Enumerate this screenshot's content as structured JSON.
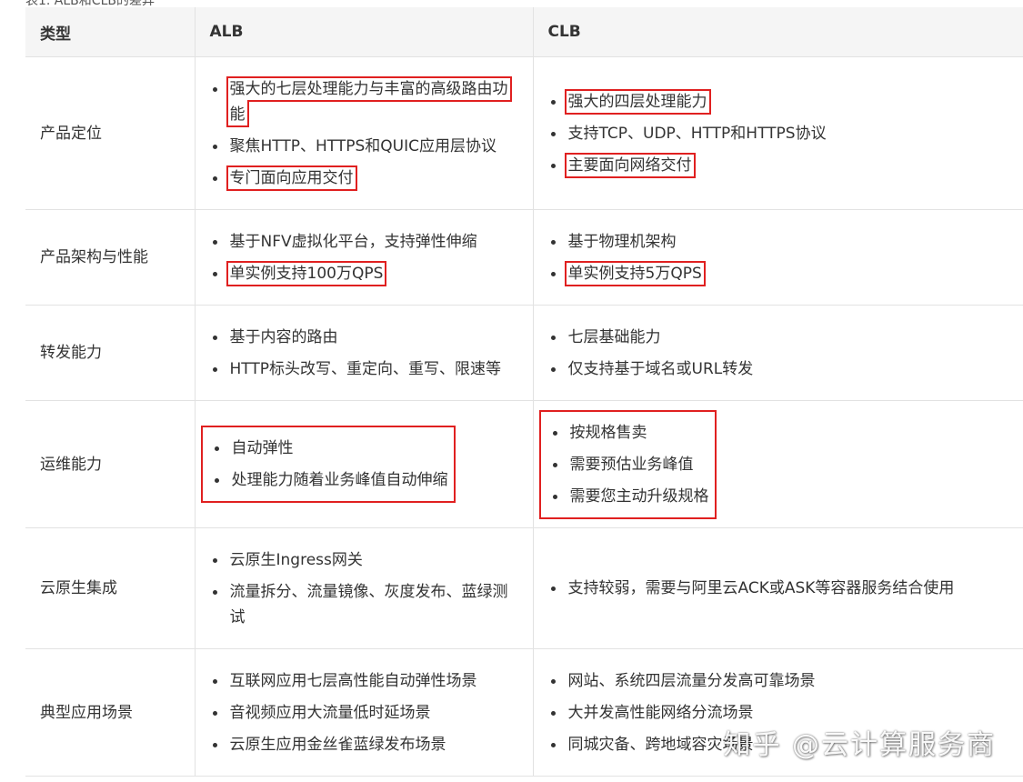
{
  "caption": "表1. ALB和CLB的差异",
  "headers": [
    "类型",
    "ALB",
    "CLB"
  ],
  "rows": [
    {
      "label": "产品定位",
      "alb": [
        "强大的七层处理能力与丰富的高级路由功能",
        "聚焦HTTP、HTTPS和QUIC应用层协议",
        "专门面向应用交付"
      ],
      "clb": [
        "强大的四层处理能力",
        "支持TCP、UDP、HTTP和HTTPS协议",
        "主要面向网络交付"
      ]
    },
    {
      "label": "产品架构与性能",
      "alb": [
        "基于NFV虚拟化平台，支持弹性伸缩",
        "单实例支持100万QPS"
      ],
      "clb": [
        "基于物理机架构",
        "单实例支持5万QPS"
      ]
    },
    {
      "label": "转发能力",
      "alb": [
        "基于内容的路由",
        "HTTP标头改写、重定向、重写、限速等"
      ],
      "clb": [
        "七层基础能力",
        "仅支持基于域名或URL转发"
      ]
    },
    {
      "label": "运维能力",
      "alb": [
        "自动弹性",
        "处理能力随着业务峰值自动伸缩"
      ],
      "clb": [
        "按规格售卖",
        "需要预估业务峰值",
        "需要您主动升级规格"
      ]
    },
    {
      "label": "云原生集成",
      "alb": [
        "云原生Ingress网关",
        "流量拆分、流量镜像、灰度发布、蓝绿测试"
      ],
      "clb": [
        "支持较弱，需要与阿里云ACK或ASK等容器服务结合使用"
      ]
    },
    {
      "label": "典型应用场景",
      "alb": [
        "互联网应用七层高性能自动弹性场景",
        "音视频应用大流量低时延场景",
        "云原生应用金丝雀蓝绿发布场景"
      ],
      "clb": [
        "网站、系统四层流量分发高可靠场景",
        "大并发高性能网络分流场景",
        "同城灾备、跨地域容灾场景"
      ]
    }
  ],
  "watermark": "知乎 @云计算服务商",
  "highlight_color": "#e02020"
}
